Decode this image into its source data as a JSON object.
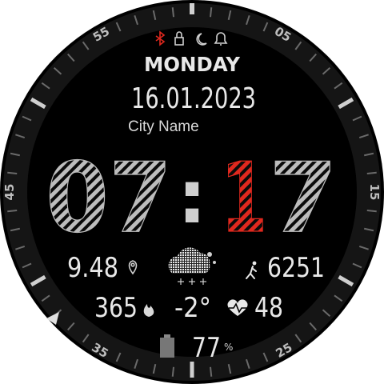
{
  "status_icons": [
    {
      "name": "bluetooth-icon",
      "color": "#e0281e"
    },
    {
      "name": "lock-icon",
      "color": "#cfcfcf"
    },
    {
      "name": "moon-icon",
      "color": "#cfcfcf"
    },
    {
      "name": "bell-icon",
      "color": "#cfcfcf"
    }
  ],
  "day_of_week": "MONDAY",
  "date": "16.01.2023",
  "city": "City Name",
  "time": {
    "hour": "07",
    "separator": ":",
    "minute_first_digit": "1",
    "minute_second_digit": "7"
  },
  "bezel_labels": {
    "n05": "05",
    "n15": "15",
    "n25": "25",
    "n35": "35",
    "n45": "45",
    "n55": "55"
  },
  "stats": {
    "distance": "9.48",
    "steps": "6251",
    "calories": "365",
    "temperature": "-2°",
    "heart_rate": "48",
    "battery": "77",
    "battery_unit": "%"
  },
  "icons": {
    "distance": "location-pin-icon",
    "weather": "cloud-snow-icon",
    "steps": "walking-person-icon",
    "calories": "flame-icon",
    "heart_rate": "heart-pulse-icon",
    "battery": "battery-icon",
    "menu": "triangle-left-icon"
  },
  "colors": {
    "background": "#000000",
    "bezel": "#151515",
    "text": "#e6e6e6",
    "accent": "#e0281e",
    "stripe": "#bdbdbd"
  }
}
